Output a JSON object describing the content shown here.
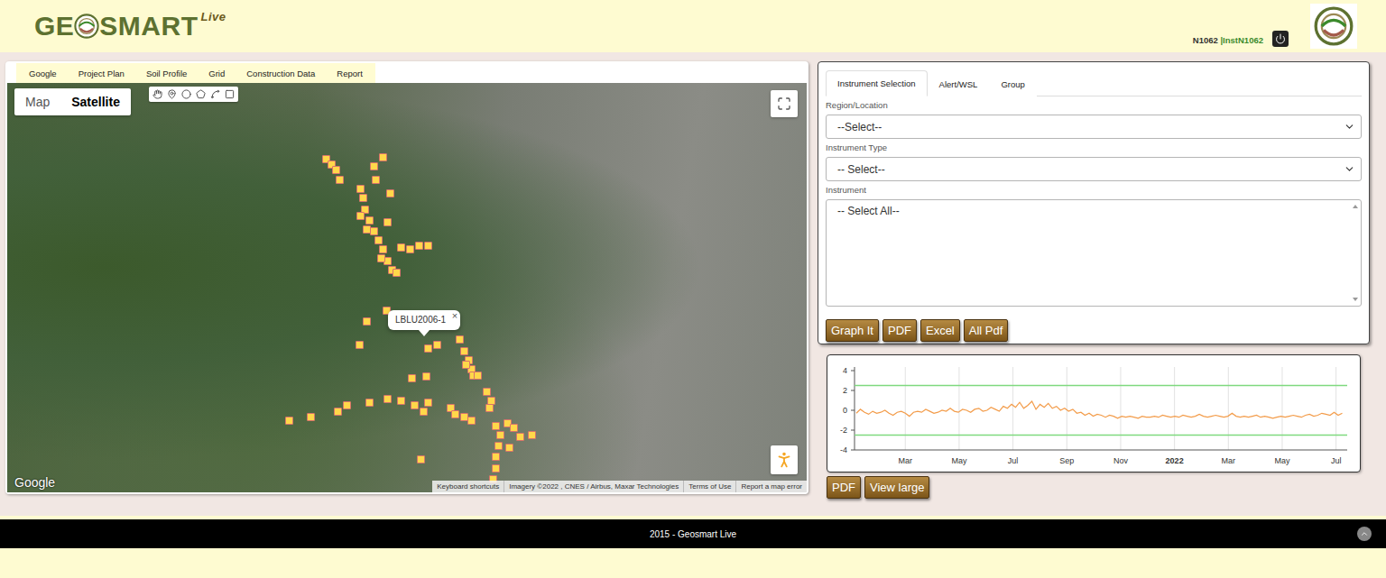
{
  "header": {
    "logo": {
      "before": "GE",
      "after": "SMART",
      "sup": "Live"
    },
    "user": "N1062",
    "instance": "|InstN1062"
  },
  "map_panel": {
    "menu": [
      "Google",
      "Project Plan",
      "Soil Profile",
      "Grid",
      "Construction Data",
      "Report"
    ],
    "map_types": [
      {
        "label": "Map",
        "selected": false
      },
      {
        "label": "Satellite",
        "selected": true
      }
    ],
    "tooltip": {
      "label": "LBLU2006-1",
      "close": "×"
    },
    "logo": "Google",
    "attribution": [
      "Keyboard shortcuts",
      "Imagery ©2022 , CNES / Airbus, Maxar Technologies",
      "Terms of Use",
      "Report a map error"
    ]
  },
  "selection_panel": {
    "tabs": [
      {
        "label": "Instrument Selection",
        "selected": true
      },
      {
        "label": "Alert/WSL",
        "selected": false
      },
      {
        "label": "Group",
        "selected": false
      }
    ],
    "fields": [
      {
        "label": "Region/Location",
        "kind": "select",
        "value": "--Select--"
      },
      {
        "label": "Instrument Type",
        "kind": "select",
        "value": "-- Select--"
      },
      {
        "label": "Instrument",
        "kind": "list",
        "value": "-- Select All--"
      }
    ],
    "buttons": [
      "Graph It",
      "PDF",
      "Excel",
      "All Pdf"
    ]
  },
  "chart": {
    "y_ticks": [
      "4",
      "2",
      "0",
      "-2",
      "-4"
    ],
    "x_ticks": [
      {
        "label": "Mar",
        "bold": false
      },
      {
        "label": "May",
        "bold": false
      },
      {
        "label": "Jul",
        "bold": false
      },
      {
        "label": "Sep",
        "bold": false
      },
      {
        "label": "Nov",
        "bold": false
      },
      {
        "label": "2022",
        "bold": true
      },
      {
        "label": "Mar",
        "bold": false
      },
      {
        "label": "May",
        "bold": false
      },
      {
        "label": "Jul",
        "bold": false
      }
    ],
    "thresholds": [
      2.5,
      -2.5
    ],
    "series": [
      {
        "values": [
          -0.3,
          0.1,
          -0.2,
          -0.4,
          -0.1,
          -0.3,
          -0.2,
          0.0,
          -0.3,
          -0.5,
          -0.2,
          -0.1,
          -0.3,
          -0.6,
          -0.2,
          -0.1,
          -0.2,
          0.1,
          -0.1,
          -0.3,
          -0.2,
          0.0,
          -0.1,
          0.2,
          -0.1,
          -0.2,
          0.1,
          0.0,
          -0.2,
          0.1,
          0.2,
          -0.1,
          0.0,
          0.3,
          0.1,
          -0.1,
          0.4,
          0.2,
          0.6,
          0.3,
          0.8,
          0.2,
          0.5,
          0.9,
          0.1,
          0.6,
          0.3,
          0.7,
          0.2,
          0.4,
          0.0,
          0.2,
          -0.1,
          0.1,
          -0.3,
          -0.2,
          -0.5,
          -0.3,
          -0.6,
          -0.4,
          -0.5,
          -0.7,
          -0.5,
          -0.6,
          -0.8,
          -0.6,
          -0.7,
          -0.6,
          -0.7,
          -0.8,
          -0.6,
          -0.7,
          -0.7,
          -0.6,
          -0.7,
          -0.5,
          -0.6,
          -0.7,
          -0.6,
          -0.7,
          -0.5,
          -0.6,
          -0.7,
          -0.6,
          -0.4,
          -0.6,
          -0.7,
          -0.6,
          -0.5,
          -0.6,
          -0.7,
          -0.6,
          -0.3,
          -0.6,
          -0.7,
          -0.6,
          -0.7,
          -0.6,
          -0.5,
          -0.7,
          -0.6,
          -0.7,
          -0.8,
          -0.7,
          -0.6,
          -0.7,
          -0.6,
          -0.5,
          -0.6,
          -0.7,
          -0.5,
          -0.4,
          -0.6,
          -0.5,
          -0.3,
          -0.4,
          -0.5,
          -0.2,
          -0.5,
          -0.3
        ]
      }
    ],
    "buttons": [
      "PDF",
      "View large"
    ]
  },
  "footer": {
    "text": "2015 - Geosmart Live"
  }
}
